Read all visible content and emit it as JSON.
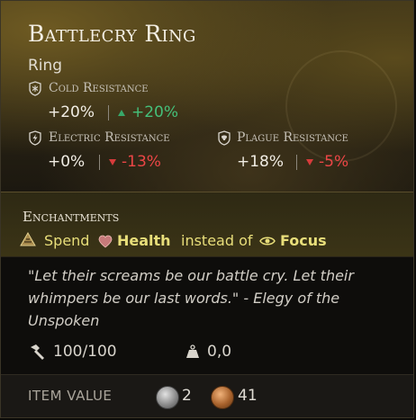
{
  "item": {
    "name": "Battlecry Ring",
    "type": "Ring"
  },
  "stats": [
    {
      "name": "Cold Resistance",
      "icon": "snowflake-shield-icon",
      "value": "+20%",
      "delta": "+20%",
      "direction": "up"
    },
    {
      "name": "Electric Resistance",
      "icon": "lightning-shield-icon",
      "value": "+0%",
      "delta": "-13%",
      "direction": "down"
    },
    {
      "name": "Plague Resistance",
      "icon": "plague-shield-icon",
      "value": "+18%",
      "delta": "-5%",
      "direction": "down"
    }
  ],
  "enchantments": {
    "title": "Enchantments",
    "line": {
      "icon": "enchant-icon",
      "spend": "Spend",
      "health": "Health",
      "instead_of": "instead of",
      "focus": "Focus"
    }
  },
  "lore": "\"Let their screams be our battle cry. Let their whimpers be our last words.\" - Elegy of the Unspoken",
  "durability": {
    "icon": "hammer-icon",
    "value": "100/100"
  },
  "weight": {
    "icon": "weight-icon",
    "value": "0,0"
  },
  "footer": {
    "label": "ITEM VALUE",
    "silver": "2",
    "copper": "41"
  },
  "colors": {
    "positive": "#45c07a",
    "negative": "#ec4646",
    "enchant_text": "#e8de7a"
  }
}
